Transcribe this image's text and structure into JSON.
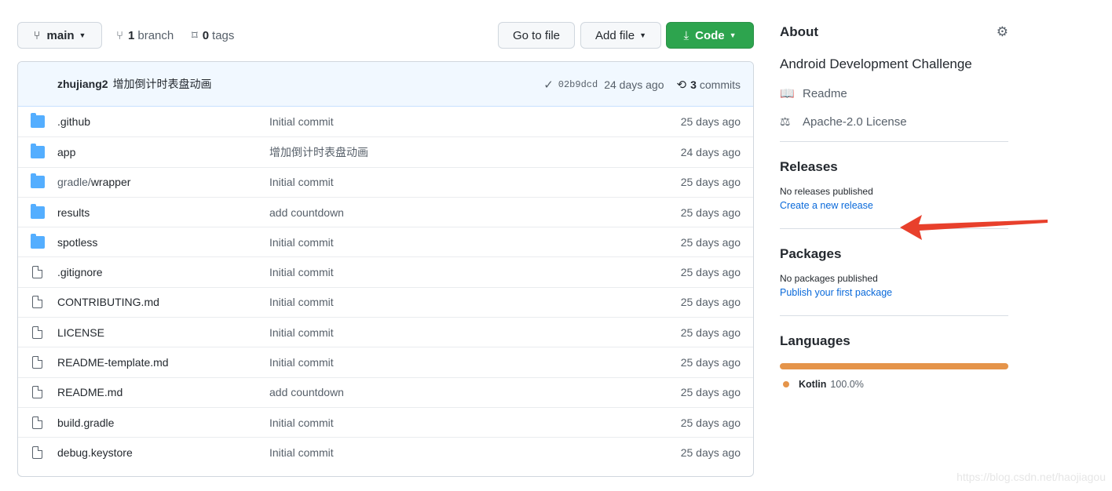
{
  "toolbar": {
    "branch_label": "main",
    "branch_count": "1",
    "branch_word": "branch",
    "tag_count": "0",
    "tag_word": "tags",
    "go_to_file": "Go to file",
    "add_file": "Add file",
    "code": "Code"
  },
  "commit": {
    "author": "zhujiang2",
    "message": "增加倒计时表盘动画",
    "sha": "02b9dcd",
    "ago": "24 days ago",
    "commit_count": "3",
    "commit_word": "commits"
  },
  "files": [
    {
      "type": "folder",
      "name": ".github",
      "message": "Initial commit",
      "age": "25 days ago"
    },
    {
      "type": "folder",
      "name": "app",
      "message": "增加倒计时表盘动画",
      "age": "24 days ago"
    },
    {
      "type": "folder",
      "name_prefix": "gradle/",
      "name": "wrapper",
      "message": "Initial commit",
      "age": "25 days ago"
    },
    {
      "type": "folder",
      "name": "results",
      "message": "add countdown",
      "age": "25 days ago"
    },
    {
      "type": "folder",
      "name": "spotless",
      "message": "Initial commit",
      "age": "25 days ago"
    },
    {
      "type": "file",
      "name": ".gitignore",
      "message": "Initial commit",
      "age": "25 days ago"
    },
    {
      "type": "file",
      "name": "CONTRIBUTING.md",
      "message": "Initial commit",
      "age": "25 days ago"
    },
    {
      "type": "file",
      "name": "LICENSE",
      "message": "Initial commit",
      "age": "25 days ago"
    },
    {
      "type": "file",
      "name": "README-template.md",
      "message": "Initial commit",
      "age": "25 days ago"
    },
    {
      "type": "file",
      "name": "README.md",
      "message": "add countdown",
      "age": "25 days ago"
    },
    {
      "type": "file",
      "name": "build.gradle",
      "message": "Initial commit",
      "age": "25 days ago"
    },
    {
      "type": "file",
      "name": "debug.keystore",
      "message": "Initial commit",
      "age": "25 days ago"
    }
  ],
  "about": {
    "title": "About",
    "description": "Android Development Challenge",
    "readme": "Readme",
    "license": "Apache-2.0 License"
  },
  "releases": {
    "title": "Releases",
    "none": "No releases published",
    "link": "Create a new release"
  },
  "packages": {
    "title": "Packages",
    "none": "No packages published",
    "link": "Publish your first package"
  },
  "languages": {
    "title": "Languages",
    "items": [
      {
        "name": "Kotlin",
        "percent": "100.0%",
        "fraction": 1.0,
        "color": "#e5944a"
      }
    ]
  },
  "watermark": "https://blog.csdn.net/haojiagou",
  "colors": {
    "accent": "#2da44e",
    "link": "#0969da",
    "annotation_arrow": "#e8402c"
  }
}
